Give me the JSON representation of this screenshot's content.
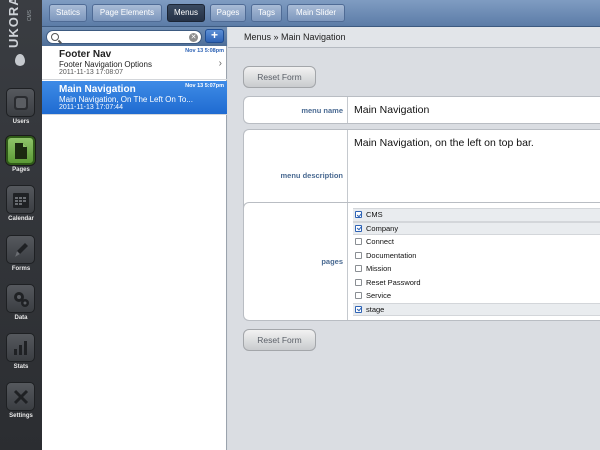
{
  "app": {
    "logo_text": "UKORA",
    "logo_sub": "CMS"
  },
  "rail": {
    "items": [
      {
        "label": "Users",
        "icon": "users-icon"
      },
      {
        "label": "Pages",
        "icon": "page-icon"
      },
      {
        "label": "Calendar",
        "icon": "calendar-icon"
      },
      {
        "label": "Forms",
        "icon": "pen-icon"
      },
      {
        "label": "Data",
        "icon": "gears-icon"
      },
      {
        "label": "Stats",
        "icon": "bar-chart-icon"
      },
      {
        "label": "Settings",
        "icon": "wrench-screwdriver-icon"
      }
    ],
    "active": "Pages"
  },
  "tabs": [
    {
      "label": "Statics"
    },
    {
      "label": "Page Elements"
    },
    {
      "label": "Menus"
    },
    {
      "label": "Pages"
    },
    {
      "label": "Tags"
    },
    {
      "label": "Main Slider"
    }
  ],
  "active_tab": "Menus",
  "search": {
    "value": "",
    "placeholder": ""
  },
  "add_button": "+",
  "list": [
    {
      "title": "Footer Nav",
      "subtitle": "Footer Navigation Options",
      "date": "2011-11-13 17:08:07",
      "time": "Nov 13 5:08pm",
      "selected": false
    },
    {
      "title": "Main Navigation",
      "subtitle": "Main Navigation, On The Left On To...",
      "date": "2011-11-13 17:07:44",
      "time": "Nov 13 5:07pm",
      "selected": true
    }
  ],
  "breadcrumb": "Menus » Main Navigation",
  "form": {
    "reset_label": "Reset Form",
    "menu_name_label": "menu name",
    "menu_name_value": "Main Navigation",
    "menu_description_label": "menu description",
    "menu_description_value": "Main Navigation, on the left on top bar.",
    "pages_label": "pages",
    "pages": [
      {
        "name": "CMS",
        "checked": true
      },
      {
        "name": "Company",
        "checked": true
      },
      {
        "name": "Connect",
        "checked": false
      },
      {
        "name": "Documentation",
        "checked": false
      },
      {
        "name": "Mission",
        "checked": false
      },
      {
        "name": "Reset Password",
        "checked": false
      },
      {
        "name": "Service",
        "checked": false
      },
      {
        "name": "stage",
        "checked": true
      }
    ]
  },
  "colors": {
    "accent": "#2e63b5",
    "selected_row": "#1f6bd1",
    "active_nav": "#6fae46"
  }
}
